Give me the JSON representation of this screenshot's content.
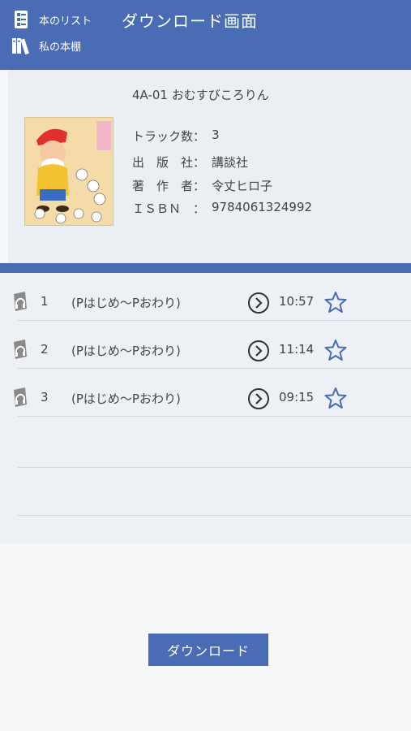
{
  "nav": {
    "book_list_label": "本のリスト",
    "bookshelf_label": "私の本棚",
    "book_list_icon": "book-list-icon",
    "bookshelf_icon": "bookshelf-icon"
  },
  "header": {
    "title": "ダウンロード画面"
  },
  "book": {
    "title": "4A-01 おむすびころりん",
    "cover_title": "おむすびころりん",
    "fields": [
      {
        "label": "トラック数：",
        "value": "3"
      },
      {
        "label": "出　版　社：",
        "value": "講談社"
      },
      {
        "label": "著　作　者：",
        "value": "令丈ヒロ子"
      },
      {
        "label": "ＩＳＢＮ　：",
        "value": "9784061324992"
      }
    ]
  },
  "tracks": [
    {
      "number": "1",
      "name": "(Pはじめ〜Pおわり)",
      "duration": "10:57"
    },
    {
      "number": "2",
      "name": "(Pはじめ〜Pおわり)",
      "duration": "11:14"
    },
    {
      "number": "3",
      "name": "(Pはじめ〜Pおわり)",
      "duration": "09:15"
    }
  ],
  "download_button": {
    "label": "ダウンロード"
  },
  "colors": {
    "accent": "#4a6cb4",
    "panel": "#ebeef3",
    "list_bg": "#edf0f5"
  }
}
